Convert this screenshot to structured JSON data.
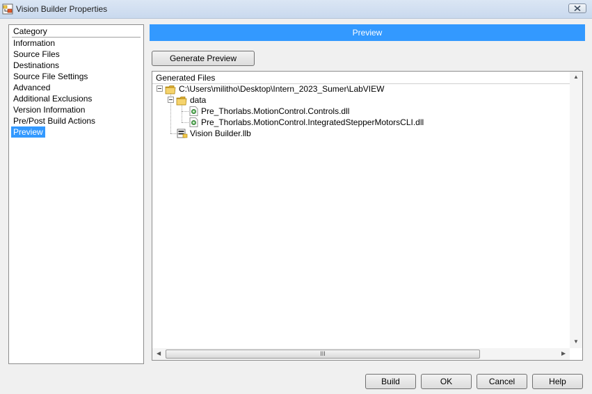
{
  "window": {
    "title": "Vision Builder Properties",
    "icon": "labview-build-icon",
    "close_icon": "close-icon"
  },
  "category": {
    "header": "Category",
    "items": [
      {
        "label": "Information"
      },
      {
        "label": "Source Files"
      },
      {
        "label": "Destinations"
      },
      {
        "label": "Source File Settings"
      },
      {
        "label": "Advanced"
      },
      {
        "label": "Additional Exclusions"
      },
      {
        "label": "Version Information"
      },
      {
        "label": "Pre/Post Build Actions"
      },
      {
        "label": "Preview"
      }
    ],
    "selected": "Preview"
  },
  "preview": {
    "banner": "Preview",
    "generate_label": "Generate Preview"
  },
  "tree": {
    "header": "Generated Files",
    "root": "C:\\Users\\militho\\Desktop\\Intern_2023_Sumer\\LabVIEW",
    "folder": "data",
    "files": [
      "Pre_Thorlabs.MotionControl.Controls.dll",
      "Pre_Thorlabs.MotionControl.IntegratedStepperMotorsCLI.dll"
    ],
    "library": "Vision Builder.llb",
    "scroll_grip": "III"
  },
  "buttons": {
    "build": "Build",
    "ok": "OK",
    "cancel": "Cancel",
    "help": "Help"
  },
  "colors": {
    "accent": "#3399ff",
    "folder": "#f2c94c"
  }
}
